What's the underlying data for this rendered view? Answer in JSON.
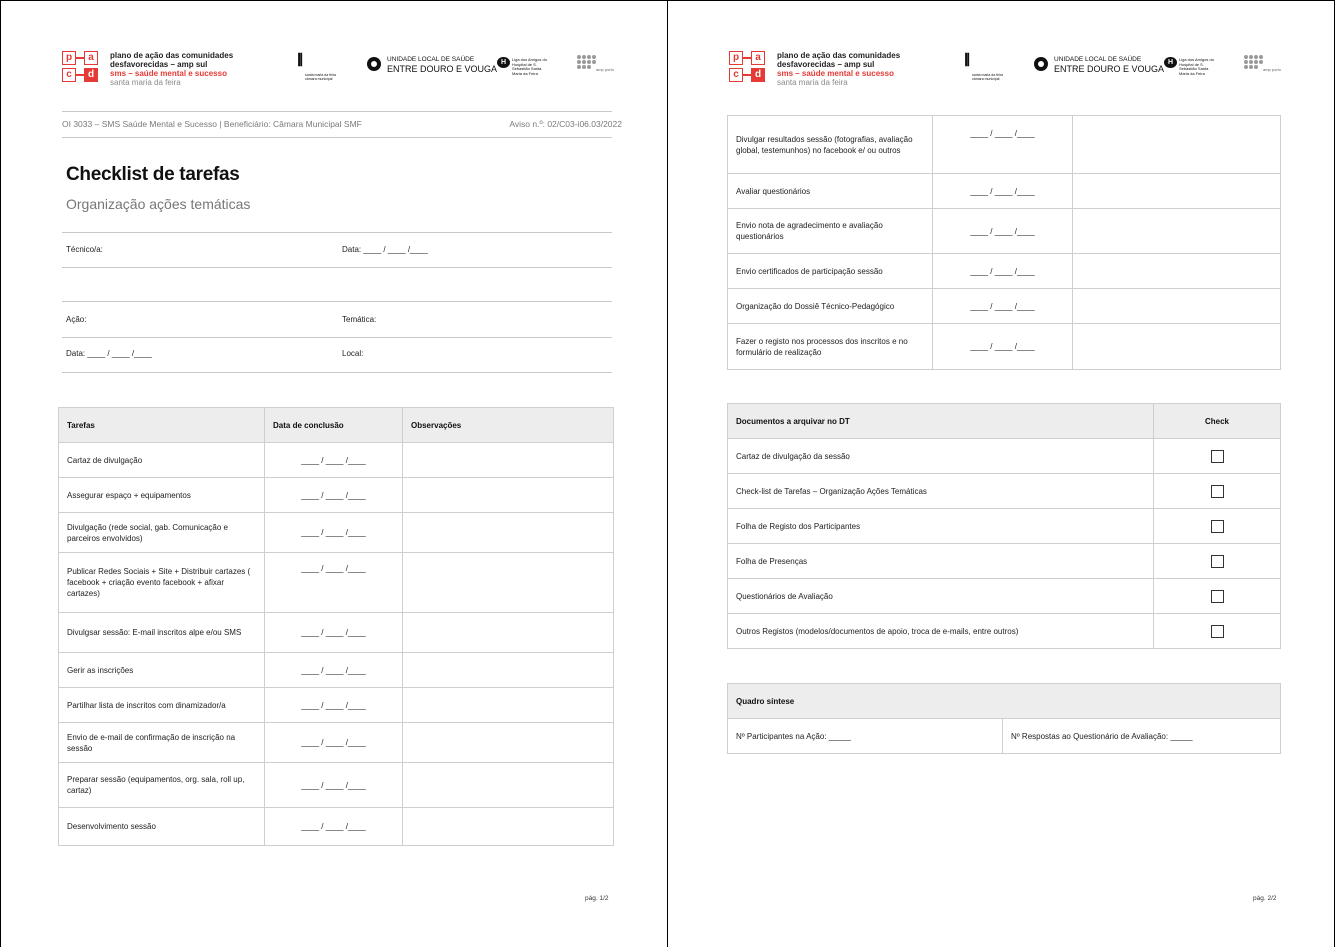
{
  "header": {
    "logo_letters": [
      "p",
      "a",
      "c",
      "d"
    ],
    "org_line1": "plano de ação das comunidades",
    "org_line2": "desfavorecidas – amp sul",
    "org_line3": "sms – saúde mental e sucesso",
    "org_line4": "santa maria da feira",
    "partner1_name": "santa maria da feira",
    "partner1_sub": "câmara municipal",
    "partner2_line1": "UNIDADE LOCAL DE SAÚDE",
    "partner2_line2": "ENTRE DOURO E VOUGA",
    "partner3_text": "Liga dos Amigos do Hospital de S. Sebastião Santa Maria da Feira",
    "partner4_text": "amp porto",
    "project_line": "OI 3033 – SMS Saúde Mental e Sucesso | Beneficiário: Câmara Municipal SMF",
    "notice_line": "Aviso n.º: 02/C03-i06.03/2022"
  },
  "page1": {
    "title": "Checklist de tarefas",
    "subtitle": "Organização ações temáticas",
    "fields": {
      "tecnico": "Técnico/a:",
      "data_top": "Data: ____ / ____ /____",
      "acao": "Ação:",
      "tematica": "Temática:",
      "data_bottom": "Data: ____ / ____ /____",
      "local": "Local:"
    },
    "table_headers": [
      "Tarefas",
      "Data de conclusão",
      "Observações"
    ],
    "date_placeholder": "____ / ____ /____",
    "tasks": [
      "Cartaz de divulgação",
      "Assegurar espaço + equipamentos",
      "Divulgação (rede social, gab. Comunicação e parceiros envolvidos)",
      "Publicar Redes Sociais + Site + Distribuir cartazes ( facebook + criação evento facebook + afixar cartazes)",
      "Divulgsar sessão: E-mail inscritos alpe e/ou SMS",
      "Gerir as inscrições",
      "Partilhar lista de inscritos com dinamizador/a",
      "Envio de e-mail de confirmação de inscrição na sessão",
      "Preparar sessão (equipamentos, org. sala, roll up, cartaz)",
      "Desenvolvimento sessão"
    ],
    "page_number": "pág. 1/2"
  },
  "page2": {
    "tasks": [
      "Divulgar resultados sessão (fotografias, avaliação global, testemunhos) no facebook e/ ou outros",
      "Avaliar questionários",
      "Envio nota de agradecimento e avaliação questionários",
      "Envio certificados de participação sessão",
      "Organização do Dossiê Técnico-Pedagógico",
      "Fazer o registo nos processos dos inscritos e no formulário de realização"
    ],
    "docs_header": "Documentos a arquivar no DT",
    "check_header": "Check",
    "documents": [
      {
        "label": "Cartaz de divulgação da sessão",
        "checked": false
      },
      {
        "label": "Check-list de Tarefas – Organização Ações Temáticas",
        "checked": false
      },
      {
        "label": "Folha de Registo dos Participantes",
        "checked": false
      },
      {
        "label": "Folha de Presenças",
        "checked": false
      },
      {
        "label": "Questionários de Avaliação",
        "checked": false
      },
      {
        "label": "Outros Registos (modelos/documentos de apoio, troca de e-mails, entre outros)",
        "checked": false
      }
    ],
    "summary_header": "Quadro síntese",
    "summary_participants": "Nº Participantes na Ação: _____",
    "summary_responses": "Nº Respostas ao Questionário de Avaliação: _____",
    "page_number": "pág. 2/2"
  },
  "colors": {
    "brand_red": "#e53a35",
    "header_fill": "#ededed",
    "rule": "#c8c8c8"
  }
}
